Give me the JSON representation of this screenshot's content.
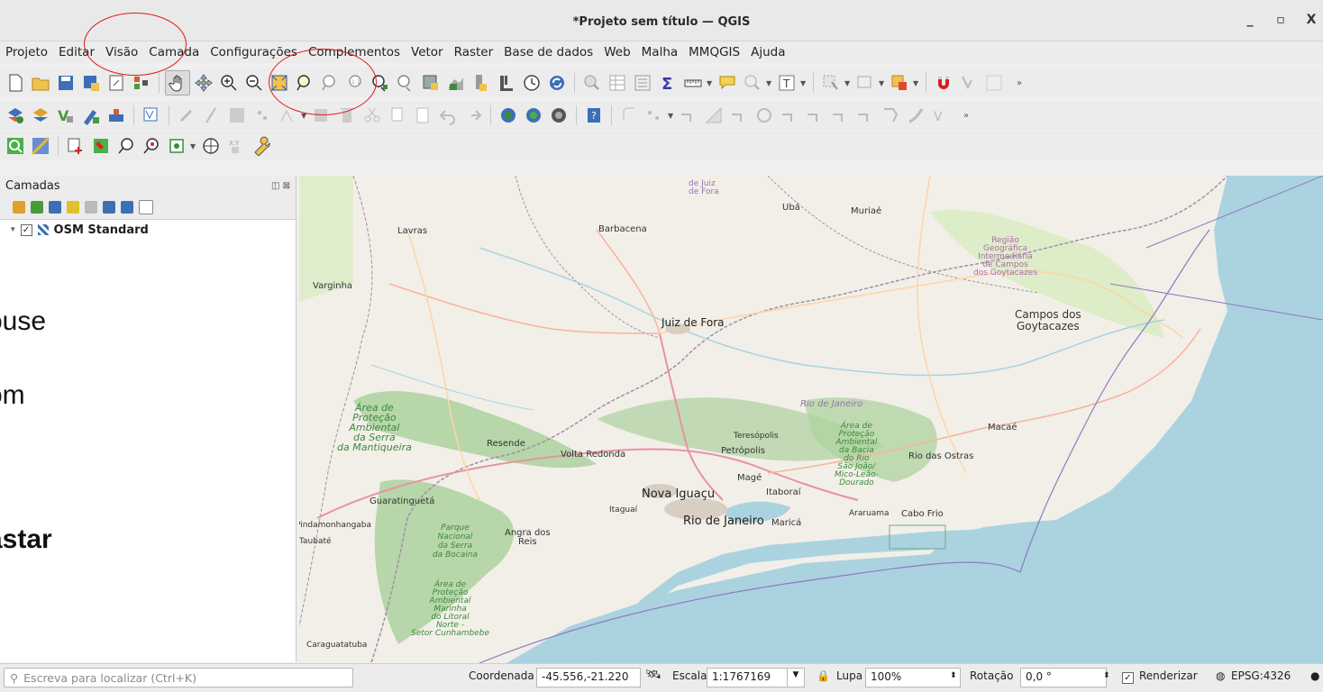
{
  "window": {
    "title": "*Projeto sem título — QGIS",
    "controls": [
      "_",
      "▫",
      "X"
    ]
  },
  "menu": [
    "Projeto",
    "Editar",
    "Visão",
    "Camada",
    "Configurações",
    "Complementos",
    "Vetor",
    "Raster",
    "Base de dados",
    "Web",
    "Malha",
    "MMQGIS",
    "Ajuda"
  ],
  "layers_panel": {
    "title": "Camadas",
    "layer_name": "OSM Standard",
    "layer_checked": "✓"
  },
  "overlay_text": {
    "line1": "ouse",
    "line2": "om",
    "line3": "astar"
  },
  "map_labels": {
    "juiz_top": "de Juiz",
    "juiz_top2": "de Fora",
    "uba": "Ubá",
    "muriae": "Muriaé",
    "lavras": "Lavras",
    "barbacena": "Barbacena",
    "varginha": "Varginha",
    "regiao1": "Região",
    "regiao2": "Geográfica",
    "regiao3": "Intermediária",
    "regiao4": "de Campos",
    "regiao5": "dos Goytacazes",
    "juiz_de_fora": "Juiz de Fora",
    "campos1": "Campos dos",
    "campos2": "Goytacazes",
    "rio_estado": "Rio de Janeiro",
    "apa1": "Área de",
    "apa2": "Proteção",
    "apa3": "Ambiental",
    "apa4": "da Serra",
    "apa5": "da Mantiqueira",
    "resende": "Resende",
    "volta_redonda": "Volta Redonda",
    "teresopolis": "Teresópolis",
    "petropolis": "Petrópolis",
    "mage": "Magé",
    "macae": "Macaé",
    "rio_das_ostras": "Rio das Ostras",
    "apa_bacia1": "Área de",
    "apa_bacia2": "Proteção",
    "apa_bacia3": "Ambiental",
    "apa_bacia4": "da Bacia",
    "apa_bacia5": "do Rio",
    "apa_bacia6": "São João/",
    "apa_bacia7": "Mico-Leão-",
    "apa_bacia8": "Dourado",
    "guaratingueta": "Guaratinguetá",
    "nova_iguacu": "Nova Iguaçu",
    "itaborai": "Itaboraí",
    "itaguai": "Itaguaí",
    "araruama": "Araruama",
    "cabo_frio": "Cabo Frio",
    "pindamonhangaba": "Pindamonhangaba",
    "rio_de_janeiro": "Rio de Janeiro",
    "marica": "Maricá",
    "taubate": "Taubaté",
    "parque1": "Parque",
    "parque2": "Nacional",
    "parque3": "da Serra",
    "parque4": "da Bocaina",
    "angra1": "Angra dos",
    "angra2": "Reis",
    "apa_marinha1": "Área de",
    "apa_marinha2": "Proteção",
    "apa_marinha3": "Ambiental",
    "apa_marinha4": "Marinha",
    "apa_marinha5": "do Litoral",
    "apa_marinha6": "Norte -",
    "apa_marinha7": "Setor Cunhambebe",
    "caraguatatuba": "Caraguatatuba"
  },
  "statusbar": {
    "search_placeholder": "Escreva para localizar (Ctrl+K)",
    "coord_label": "Coordenada",
    "coord_value": "-45.556,-21.220",
    "scale_label": "Escala",
    "scale_value": "1:1767169",
    "lupa_label": "Lupa",
    "lupa_value": "100%",
    "rotation_label": "Rotação",
    "rotation_value": "0,0 °",
    "render_label": "Renderizar",
    "crs": "EPSG:4326"
  },
  "colors": {
    "annotation": "#e01818",
    "sea": "#aad3df",
    "land": "#f2efe9",
    "forest": "#add19e"
  }
}
